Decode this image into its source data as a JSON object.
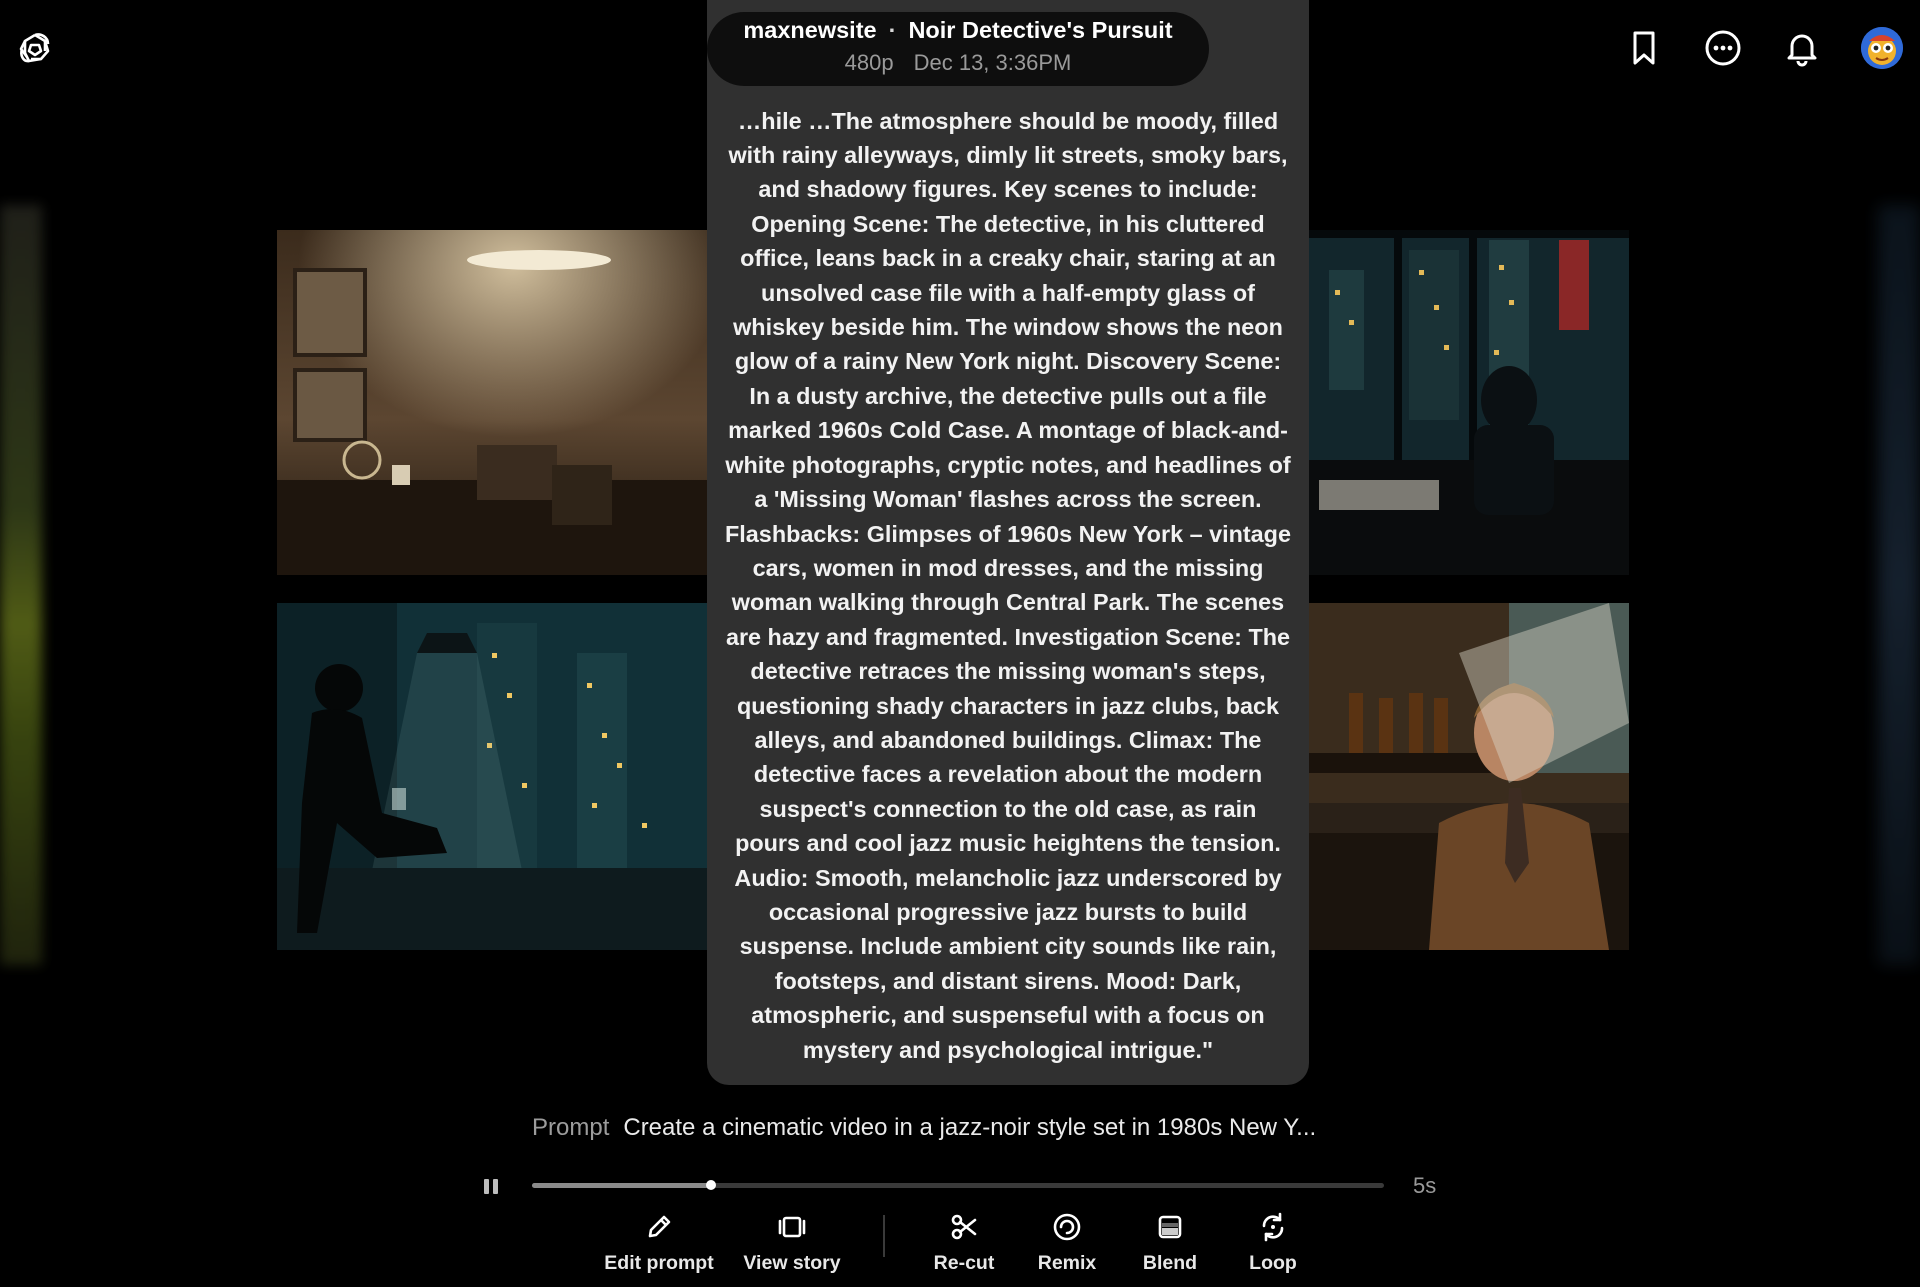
{
  "header": {
    "logo_icon": "openai-logo-icon",
    "icons": [
      "bookmark-icon",
      "more-icon",
      "bell-icon",
      "avatar"
    ]
  },
  "video": {
    "author": "maxnewsite",
    "separator": "·",
    "title": "Noir Detective's Pursuit",
    "resolution": "480p",
    "date": "Dec 13, 3:36PM"
  },
  "prompt_overlay": {
    "text": "…hile …The atmosphere should be moody, filled with rainy alleyways, dimly lit streets, smoky bars, and shadowy figures. Key scenes to include: Opening Scene: The detective, in his cluttered office, leans back in a creaky chair, staring at an unsolved case file with a half-empty glass of whiskey beside him. The window shows the neon glow of a rainy New York night. Discovery Scene: In a dusty archive, the detective pulls out a file marked 1960s Cold Case. A montage of black-and-white photographs, cryptic notes, and headlines of a 'Missing Woman' flashes across the screen. Flashbacks: Glimpses of 1960s New York – vintage cars, women in mod dresses, and the missing woman walking through Central Park. The scenes are hazy and fragmented. Investigation Scene: The detective retraces the missing woman's steps, questioning shady characters in jazz clubs, back alleys, and abandoned buildings. Climax: The detective faces a revelation about the modern suspect's connection to the old case, as rain pours and cool jazz music heightens the tension. Audio: Smooth, melancholic jazz underscored by occasional progressive jazz bursts to build suspense. Include ambient city sounds like rain, footsteps, and distant sirens. Mood: Dark, atmospheric, and suspenseful with a focus on mystery and psychological intrigue.\""
  },
  "prompt_line": {
    "label": "Prompt",
    "value": "Create a cinematic video in a jazz-noir style set in 1980s New Y..."
  },
  "player": {
    "state_icon": "pause-icon",
    "progress": 0.21,
    "duration": "5s"
  },
  "toolbar": {
    "items": [
      {
        "label": "Edit prompt",
        "icon": "pencil-icon"
      },
      {
        "label": "View story",
        "icon": "storyboard-icon"
      },
      {
        "label": "Re-cut",
        "icon": "scissors-icon"
      },
      {
        "label": "Remix",
        "icon": "remix-icon"
      },
      {
        "label": "Blend",
        "icon": "blend-icon"
      },
      {
        "label": "Loop",
        "icon": "loop-icon"
      }
    ]
  }
}
